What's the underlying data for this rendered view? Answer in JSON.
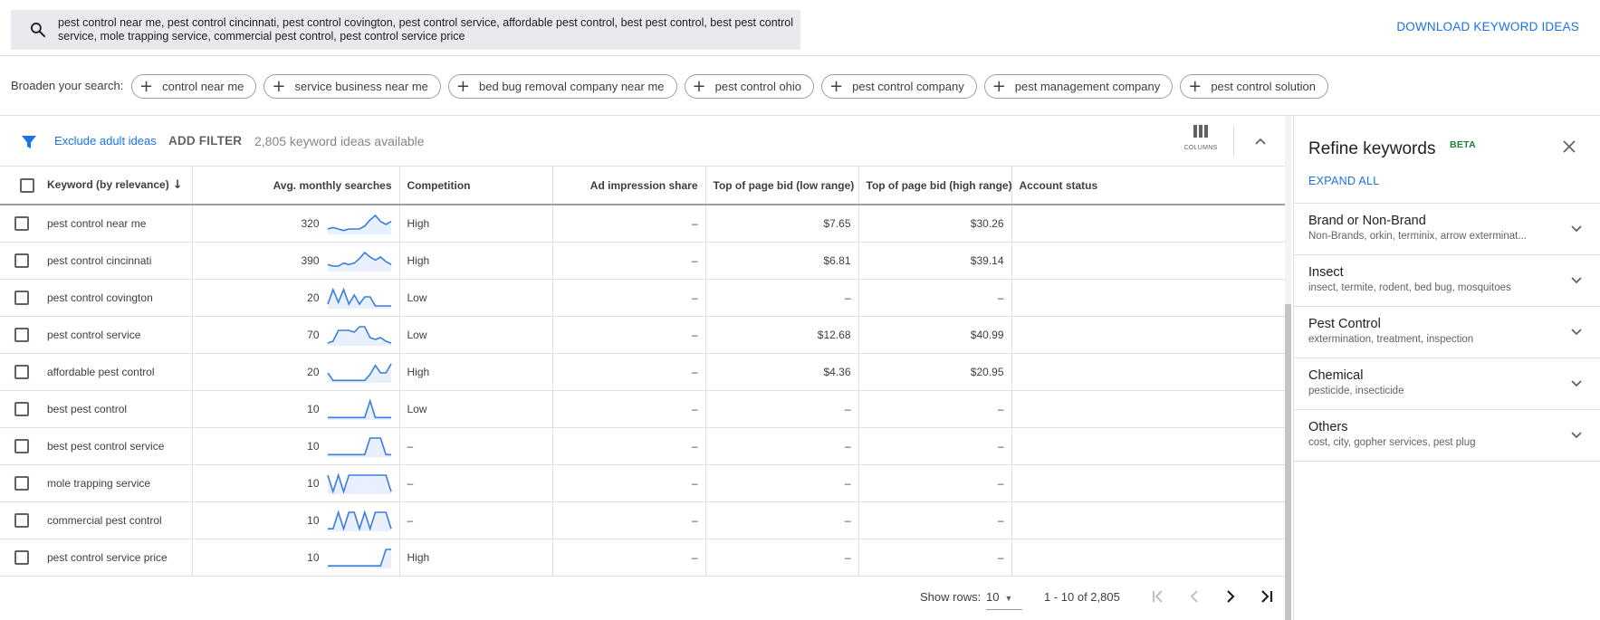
{
  "search": {
    "query": "pest control near me, pest control cincinnati, pest control covington, pest control service, affordable pest control, best pest control, best pest control service, mole trapping service, commercial pest control, pest control service price",
    "download_label": "DOWNLOAD KEYWORD IDEAS"
  },
  "broaden": {
    "label": "Broaden your search:",
    "chips": [
      "control near me",
      "service business near me",
      "bed bug removal company near me",
      "pest control ohio",
      "pest control company",
      "pest management company",
      "pest control solution"
    ]
  },
  "toolbar": {
    "exclude_adult": "Exclude adult ideas",
    "add_filter": "ADD FILTER",
    "ideas_count": "2,805 keyword ideas available",
    "columns_label": "COLUMNS"
  },
  "table": {
    "headers": {
      "keyword": "Keyword (by relevance)",
      "searches": "Avg. monthly searches",
      "competition": "Competition",
      "impression": "Ad impression share",
      "bid_low": "Top of page bid (low range)",
      "bid_high": "Top of page bid (high range)",
      "account_status": "Account status"
    },
    "rows": [
      {
        "keyword": "pest control near me",
        "searches": "320",
        "trend": [
          3,
          4,
          3,
          2,
          3,
          3,
          3,
          5,
          9,
          12,
          8,
          6,
          8
        ],
        "competition": "High",
        "impression": "–",
        "bid_low": "$7.65",
        "bid_high": "$30.26",
        "account_status": ""
      },
      {
        "keyword": "pest control cincinnati",
        "searches": "390",
        "trend": [
          4,
          3,
          3,
          5,
          4,
          5,
          8,
          12,
          9,
          7,
          9,
          6,
          4
        ],
        "competition": "High",
        "impression": "–",
        "bid_low": "$6.81",
        "bid_high": "$39.14",
        "account_status": ""
      },
      {
        "keyword": "pest control covington",
        "searches": "20",
        "trend": [
          2,
          10,
          3,
          10,
          2,
          7,
          2,
          6,
          6,
          1,
          1,
          1,
          1
        ],
        "competition": "Low",
        "impression": "–",
        "bid_low": "–",
        "bid_high": "–",
        "account_status": ""
      },
      {
        "keyword": "pest control service",
        "searches": "70",
        "trend": [
          1,
          2,
          8,
          8,
          8,
          7,
          10,
          10,
          4,
          3,
          4,
          2,
          1
        ],
        "competition": "Low",
        "impression": "–",
        "bid_low": "$12.68",
        "bid_high": "$40.99",
        "account_status": ""
      },
      {
        "keyword": "affordable pest control",
        "searches": "20",
        "trend": [
          6,
          1,
          1,
          1,
          1,
          1,
          1,
          1,
          5,
          11,
          6,
          6,
          12
        ],
        "competition": "High",
        "impression": "–",
        "bid_low": "$4.36",
        "bid_high": "$20.95",
        "account_status": ""
      },
      {
        "keyword": "best pest control",
        "searches": "10",
        "trend": [
          1,
          1,
          1,
          1,
          1,
          1,
          1,
          1,
          12,
          1,
          1,
          1,
          1
        ],
        "competition": "Low",
        "impression": "–",
        "bid_low": "–",
        "bid_high": "–",
        "account_status": ""
      },
      {
        "keyword": "best pest control service",
        "searches": "10",
        "trend": [
          1,
          1,
          1,
          1,
          1,
          1,
          1,
          1,
          12,
          12,
          12,
          1,
          1
        ],
        "competition": "–",
        "impression": "–",
        "bid_low": "–",
        "bid_high": "–",
        "account_status": ""
      },
      {
        "keyword": "mole trapping service",
        "searches": "10",
        "trend": [
          11,
          1,
          11,
          1,
          11,
          11,
          11,
          11,
          11,
          11,
          11,
          11,
          1
        ],
        "competition": "–",
        "impression": "–",
        "bid_low": "–",
        "bid_high": "–",
        "account_status": ""
      },
      {
        "keyword": "commercial pest control",
        "searches": "10",
        "trend": [
          1,
          1,
          11,
          1,
          11,
          11,
          1,
          11,
          1,
          11,
          11,
          11,
          1
        ],
        "competition": "–",
        "impression": "–",
        "bid_low": "–",
        "bid_high": "–",
        "account_status": ""
      },
      {
        "keyword": "pest control service price",
        "searches": "10",
        "trend": [
          1,
          1,
          1,
          1,
          1,
          1,
          1,
          1,
          1,
          1,
          1,
          11,
          11
        ],
        "competition": "High",
        "impression": "–",
        "bid_low": "–",
        "bid_high": "–",
        "account_status": ""
      }
    ]
  },
  "pager": {
    "show_rows_label": "Show rows:",
    "rows_value": "10",
    "range": "1 - 10 of 2,805"
  },
  "refine": {
    "title": "Refine keywords",
    "beta": "BETA",
    "expand_all": "EXPAND ALL",
    "groups": [
      {
        "name": "Brand or Non-Brand",
        "sub": "Non-Brands, orkin, terminix, arrow exterminat..."
      },
      {
        "name": "Insect",
        "sub": "insect, termite, rodent, bed bug, mosquitoes"
      },
      {
        "name": "Pest Control",
        "sub": "extermination, treatment, inspection"
      },
      {
        "name": "Chemical",
        "sub": "pesticide, insecticide"
      },
      {
        "name": "Others",
        "sub": "cost, city, gopher services, pest plug"
      }
    ]
  },
  "colors": {
    "accent": "#1a73e8",
    "spark_line": "#3b7ddd",
    "spark_fill": "#e8f0fe",
    "beta_green": "#188038"
  }
}
